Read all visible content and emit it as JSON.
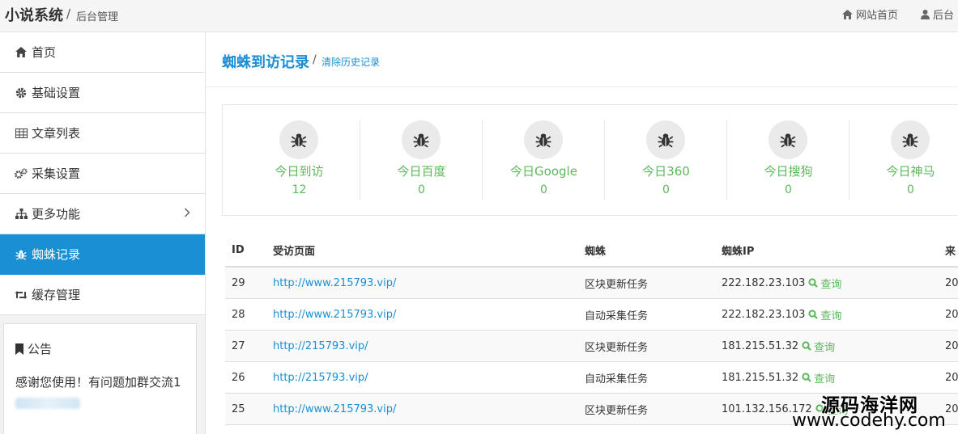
{
  "header": {
    "brand": "小说系统",
    "separator": "/",
    "subtitle": "后台管理",
    "links": [
      {
        "icon": "home-icon",
        "label": "网站首页"
      },
      {
        "icon": "user-icon",
        "label": "后台"
      }
    ]
  },
  "sidebar": {
    "items": [
      {
        "icon": "home-icon",
        "label": "首页"
      },
      {
        "icon": "gear-icon",
        "label": "基础设置"
      },
      {
        "icon": "table-icon",
        "label": "文章列表"
      },
      {
        "icon": "gears-icon",
        "label": "采集设置"
      },
      {
        "icon": "sitemap-icon",
        "label": "更多功能"
      },
      {
        "icon": "bug-icon",
        "label": "蜘蛛记录"
      },
      {
        "icon": "retweet-icon",
        "label": "缓存管理"
      }
    ],
    "active_index": 5,
    "notice": {
      "icon": "bookmark-icon",
      "title": "公告",
      "text": "感谢您使用！有问题加群交流1"
    }
  },
  "page": {
    "title": "蜘蛛到访记录",
    "separator": "/",
    "action": "清除历史记录"
  },
  "stats": [
    {
      "icon": "bug-icon",
      "label": "今日到访",
      "value": "12"
    },
    {
      "icon": "bug-icon",
      "label": "今日百度",
      "value": "0"
    },
    {
      "icon": "bug-icon",
      "label": "今日Google",
      "value": "0"
    },
    {
      "icon": "bug-icon",
      "label": "今日360",
      "value": "0"
    },
    {
      "icon": "bug-icon",
      "label": "今日搜狗",
      "value": "0"
    },
    {
      "icon": "bug-icon",
      "label": "今日神马",
      "value": "0"
    }
  ],
  "table": {
    "columns": [
      "ID",
      "受访页面",
      "蜘蛛",
      "蜘蛛IP",
      "来"
    ],
    "query_label": "查询",
    "rows": [
      {
        "id": "29",
        "url": "http://www.215793.vip/",
        "spider": "区块更新任务",
        "ip": "222.182.23.103",
        "time": "20"
      },
      {
        "id": "28",
        "url": "http://www.215793.vip/",
        "spider": "自动采集任务",
        "ip": "222.182.23.103",
        "time": "20"
      },
      {
        "id": "27",
        "url": "http://215793.vip/",
        "spider": "区块更新任务",
        "ip": "181.215.51.32",
        "time": "20"
      },
      {
        "id": "26",
        "url": "http://215793.vip/",
        "spider": "自动采集任务",
        "ip": "181.215.51.32",
        "time": "20"
      },
      {
        "id": "25",
        "url": "http://www.215793.vip/",
        "spider": "区块更新任务",
        "ip": "101.132.156.172",
        "time": "20"
      }
    ]
  },
  "watermark": {
    "line1": "源码海洋网",
    "line2": "www.codehy.com"
  },
  "colors": {
    "accent": "#1a8fd4",
    "success": "#5cb85c",
    "sidebar_bg": "#f2f2f2"
  }
}
